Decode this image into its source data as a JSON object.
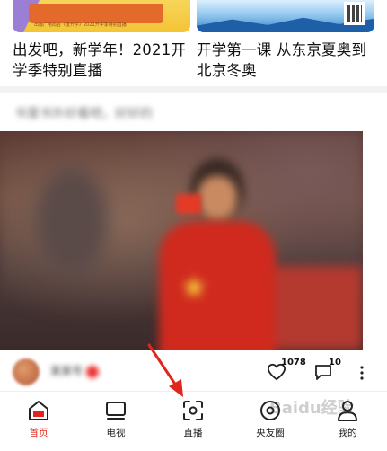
{
  "cards": [
    {
      "thumb_caption": "出版广电局合《度开学》2021开学季特别直播",
      "title": "出发吧，新学年！2021开学季特别直播"
    },
    {
      "thumb_caption": "",
      "title": "开学第一课 从东京夏奥到北京冬奥"
    }
  ],
  "post": {
    "title": "书里书外好看吧，好好的",
    "author_name": "某某号",
    "likes": "1078",
    "comments": "10"
  },
  "nav": {
    "items": [
      {
        "label": "首页",
        "icon": "home-icon",
        "active": true
      },
      {
        "label": "电视",
        "icon": "tv-icon",
        "active": false
      },
      {
        "label": "直播",
        "icon": "live-icon",
        "active": false
      },
      {
        "label": "央友圈",
        "icon": "circle-icon",
        "active": false
      },
      {
        "label": "我的",
        "icon": "profile-icon",
        "active": false
      }
    ]
  },
  "watermark": "Baidu经验",
  "colors": {
    "accent": "#e0261c",
    "annotation_arrow": "#e0261c"
  }
}
